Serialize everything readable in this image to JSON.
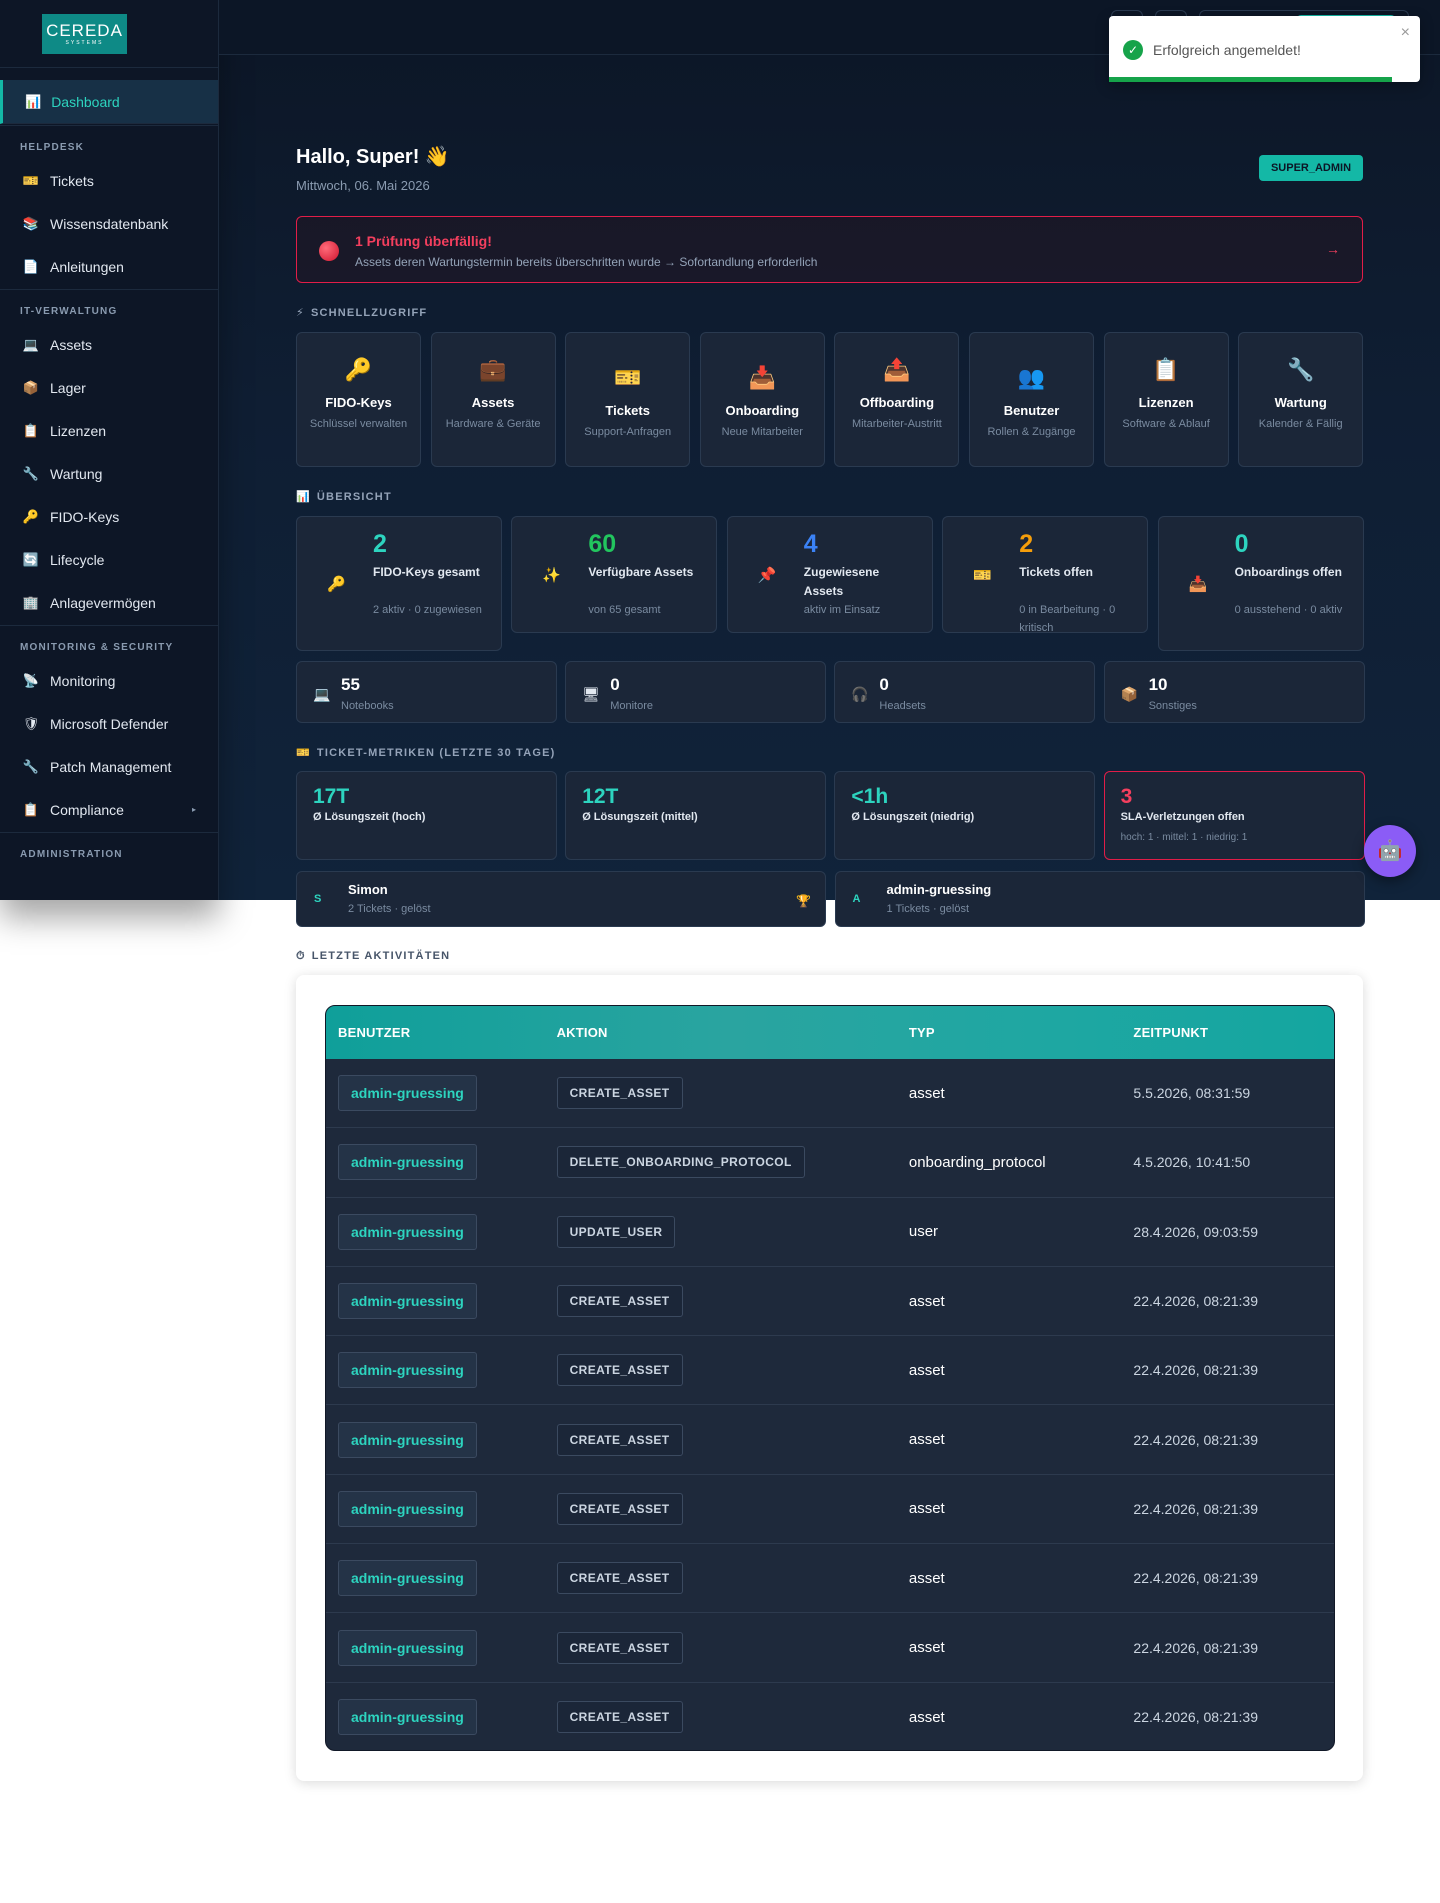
{
  "app": {
    "logo_main": "CEREDA",
    "logo_sub": "SYSTEMS"
  },
  "sidebar": {
    "active": {
      "label": "Dashboard",
      "icon": "chart-icon"
    },
    "sections": [
      {
        "title": "HELPDESK",
        "items": [
          {
            "label": "Tickets",
            "icon": "ticket-icon"
          },
          {
            "label": "Wissensdatenbank",
            "icon": "books-icon"
          },
          {
            "label": "Anleitungen",
            "icon": "document-icon"
          }
        ]
      },
      {
        "title": "IT-VERWALTUNG",
        "items": [
          {
            "label": "Assets",
            "icon": "laptop-icon"
          },
          {
            "label": "Lager",
            "icon": "package-icon"
          },
          {
            "label": "Lizenzen",
            "icon": "clipboard-icon"
          },
          {
            "label": "Wartung",
            "icon": "wrench-icon"
          },
          {
            "label": "FIDO-Keys",
            "icon": "key-icon"
          },
          {
            "label": "Lifecycle",
            "icon": "cycle-icon"
          },
          {
            "label": "Anlagevermögen",
            "icon": "building-icon"
          }
        ]
      },
      {
        "title": "MONITORING & SECURITY",
        "items": [
          {
            "label": "Monitoring",
            "icon": "satellite-icon"
          },
          {
            "label": "Microsoft Defender",
            "icon": "shield-icon"
          },
          {
            "label": "Patch Management",
            "icon": "wrench-icon"
          },
          {
            "label": "Compliance",
            "icon": "clipboard-icon"
          }
        ]
      },
      {
        "title": "ADMINISTRATION",
        "items": []
      }
    ]
  },
  "toast": {
    "message": "Erfolgreich angemeldet!",
    "close": "×"
  },
  "header": {
    "greeting": "Hallo, Super! 👋",
    "date": "Mittwoch, 06. Mai 2026",
    "role": "SUPER_ADMIN"
  },
  "alert": {
    "title": "1 Prüfung überfällig!",
    "text": "Assets deren Wartungstermin bereits überschritten wurde → Sofortandlung erforderlich",
    "arrow": "→"
  },
  "quick_access": {
    "title": "SCHNELLZUGRIFF",
    "cards": [
      {
        "title": "FIDO-Keys",
        "sub": "Schlüssel verwalten",
        "glyph": "🔑"
      },
      {
        "title": "Assets",
        "sub": "Hardware & Geräte",
        "glyph": "💼"
      },
      {
        "title": "Tickets",
        "sub": "Support-Anfragen",
        "glyph": "🎫"
      },
      {
        "title": "Onboarding",
        "sub": "Neue Mitarbeiter",
        "glyph": "📥"
      },
      {
        "title": "Offboarding",
        "sub": "Mitarbeiter-Austritt",
        "glyph": "📤"
      },
      {
        "title": "Benutzer",
        "sub": "Rollen & Zugänge",
        "glyph": "👥"
      },
      {
        "title": "Lizenzen",
        "sub": "Software & Ablauf",
        "glyph": "📋"
      },
      {
        "title": "Wartung",
        "sub": "Kalender & Fällig",
        "glyph": "🔧"
      }
    ]
  },
  "overview": {
    "title": "ÜBERSICHT",
    "cards": [
      {
        "value": "2",
        "label": "FIDO-Keys gesamt",
        "sub": "2 aktiv · 0 zugewiesen",
        "color": "#2dd4bf",
        "glyph": "🔑"
      },
      {
        "value": "60",
        "label": "Verfügbare Assets",
        "sub": "von 65 gesamt",
        "color": "#22c55e",
        "glyph": "✨"
      },
      {
        "value": "4",
        "label": "Zugewiesene Assets",
        "sub": "aktiv im Einsatz",
        "color": "#3b82f6",
        "glyph": "📌"
      },
      {
        "value": "2",
        "label": "Tickets offen",
        "sub": "0 in Bearbeitung · 0 kritisch",
        "color": "#f59e0b",
        "glyph": "🎫"
      },
      {
        "value": "0",
        "label": "Onboardings offen",
        "sub": "0 ausstehend · 0 aktiv",
        "color": "#2dd4bf",
        "glyph": "📥"
      }
    ],
    "devices": [
      {
        "value": "55",
        "label": "Notebooks",
        "glyph": "💻"
      },
      {
        "value": "0",
        "label": "Monitore",
        "glyph": "🖥"
      },
      {
        "value": "0",
        "label": "Headsets",
        "glyph": "🎧"
      },
      {
        "value": "10",
        "label": "Sonstiges",
        "glyph": "📦"
      }
    ]
  },
  "metrics": {
    "title": "TICKET-METRIKEN (LETZTE 30 TAGE)",
    "cards": [
      {
        "value": "17T",
        "label": "Ø Lösungszeit (hoch)"
      },
      {
        "value": "12T",
        "label": "Ø Lösungszeit (mittel)"
      },
      {
        "value": "<1h",
        "label": "Ø Lösungszeit (niedrig)"
      },
      {
        "value": "3",
        "label": "SLA-Verletzungen offen",
        "sub": "hoch: 1 · mittel: 1 · niedrig: 1"
      }
    ],
    "resolvers": [
      {
        "initial": "S",
        "name": "Simon",
        "sub": "2 Tickets · gelöst",
        "trophy": "🏆"
      },
      {
        "initial": "A",
        "name": "admin-gruessing",
        "sub": "1 Tickets · gelöst"
      }
    ]
  },
  "activities": {
    "title": "LETZTE AKTIVITÄTEN",
    "columns": [
      "BENUTZER",
      "AKTION",
      "TYP",
      "ZEITPUNKT"
    ],
    "rows": [
      {
        "user": "admin-gruessing",
        "action": "CREATE_ASSET",
        "type": "asset",
        "time": "5.5.2026, 08:31:59"
      },
      {
        "user": "admin-gruessing",
        "action": "DELETE_ONBOARDING_PROTOCOL",
        "type": "onboarding_protocol",
        "time": "4.5.2026, 10:41:50"
      },
      {
        "user": "admin-gruessing",
        "action": "UPDATE_USER",
        "type": "user",
        "time": "28.4.2026, 09:03:59"
      },
      {
        "user": "admin-gruessing",
        "action": "CREATE_ASSET",
        "type": "asset",
        "time": "22.4.2026, 08:21:39"
      },
      {
        "user": "admin-gruessing",
        "action": "CREATE_ASSET",
        "type": "asset",
        "time": "22.4.2026, 08:21:39"
      },
      {
        "user": "admin-gruessing",
        "action": "CREATE_ASSET",
        "type": "asset",
        "time": "22.4.2026, 08:21:39"
      },
      {
        "user": "admin-gruessing",
        "action": "CREATE_ASSET",
        "type": "asset",
        "time": "22.4.2026, 08:21:39"
      },
      {
        "user": "admin-gruessing",
        "action": "CREATE_ASSET",
        "type": "asset",
        "time": "22.4.2026, 08:21:39"
      },
      {
        "user": "admin-gruessing",
        "action": "CREATE_ASSET",
        "type": "asset",
        "time": "22.4.2026, 08:21:39"
      },
      {
        "user": "admin-gruessing",
        "action": "CREATE_ASSET",
        "type": "asset",
        "time": "22.4.2026, 08:21:39"
      }
    ]
  },
  "glyphs": {
    "chatbot": "🤖",
    "check": "✓",
    "alert_section": "⚡",
    "overview_section": "📊",
    "metrics_section": "🎫",
    "activities_section": "⏱",
    "chevron": "▸"
  }
}
